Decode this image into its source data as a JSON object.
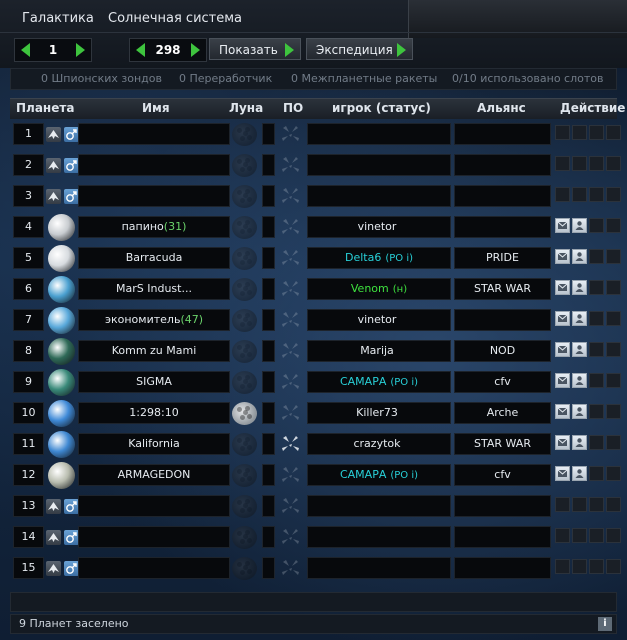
{
  "tabs": [
    "Галактика",
    "Солнечная система"
  ],
  "galaxy_value": "1",
  "system_value": "298",
  "buttons": {
    "show": "Показать",
    "expedition": "Экспедиция"
  },
  "stats": [
    "0 Шпионских зондов",
    "0 Переработчик",
    "0 Межпланетные ракеты",
    "0/10 использовано слотов"
  ],
  "columns": [
    "Планета",
    "Имя",
    "Луна",
    "ПО",
    "игрок (статус)",
    "Альянс",
    "Действие"
  ],
  "rows": [
    {
      "pos": "1",
      "name": "",
      "name_extra": "",
      "player": "",
      "player_status": "",
      "alliance": "",
      "planet": false,
      "moon": false,
      "debris": false,
      "actions": false
    },
    {
      "pos": "2",
      "name": "",
      "name_extra": "",
      "player": "",
      "player_status": "",
      "alliance": "",
      "planet": false,
      "moon": false,
      "debris": false,
      "actions": false
    },
    {
      "pos": "3",
      "name": "",
      "name_extra": "",
      "player": "",
      "player_status": "",
      "alliance": "",
      "planet": false,
      "moon": false,
      "debris": false,
      "actions": false
    },
    {
      "pos": "4",
      "name": "папино",
      "name_extra": "(31)",
      "player": "vinetor",
      "player_status": "",
      "alliance": "",
      "planet": true,
      "planet_color": "#c8ccd0",
      "moon": false,
      "debris": false,
      "actions": true,
      "player_color": "#e6ebf0"
    },
    {
      "pos": "5",
      "name": "Barracuda",
      "name_extra": "",
      "player": "Delta6",
      "player_status": "(PO i)",
      "alliance": "PRIDE",
      "planet": true,
      "planet_color": "#d7dbdf",
      "moon": false,
      "debris": false,
      "actions": true,
      "player_color": "#28d0d8"
    },
    {
      "pos": "6",
      "name": "MarS Indust...",
      "name_extra": "",
      "player": "Venom",
      "player_status": "(н)",
      "alliance": "STAR WAR",
      "planet": true,
      "planet_color": "#4aa0d0",
      "moon": false,
      "debris": false,
      "actions": true,
      "player_color": "#3ee23e"
    },
    {
      "pos": "7",
      "name": "экономитель",
      "name_extra": "(47)",
      "player": "vinetor",
      "player_status": "",
      "alliance": "",
      "planet": true,
      "planet_color": "#58a8da",
      "moon": false,
      "debris": false,
      "actions": true,
      "player_color": "#e6ebf0"
    },
    {
      "pos": "8",
      "name": "Komm zu Mami",
      "name_extra": "",
      "player": "Marija",
      "player_status": "",
      "alliance": "NOD",
      "planet": true,
      "planet_color": "#2f6a58",
      "moon": false,
      "debris": false,
      "actions": true,
      "player_color": "#e6ebf0"
    },
    {
      "pos": "9",
      "name": "SIGMA",
      "name_extra": "",
      "player": "САМАРА",
      "player_status": "(PO i)",
      "alliance": "cfv",
      "planet": true,
      "planet_color": "#3a8a7a",
      "moon": false,
      "debris": false,
      "actions": true,
      "player_color": "#28d0d8"
    },
    {
      "pos": "10",
      "name": "1:298:10",
      "name_extra": "",
      "player": "Killer73",
      "player_status": "",
      "alliance": "Arche",
      "planet": true,
      "planet_color": "#3f8ad8",
      "moon": true,
      "debris": false,
      "actions": true,
      "player_color": "#e6ebf0"
    },
    {
      "pos": "11",
      "name": "Kalifornia",
      "name_extra": "",
      "player": "crazytok",
      "player_status": "",
      "alliance": "STAR WAR",
      "planet": true,
      "planet_color": "#3f88d2",
      "moon": false,
      "debris": true,
      "actions": true,
      "player_color": "#e6ebf0"
    },
    {
      "pos": "12",
      "name": "ARMAGEDON",
      "name_extra": "",
      "player": "САМАРА",
      "player_status": "(PO i)",
      "alliance": "cfv",
      "planet": true,
      "planet_color": "#b8bcae",
      "moon": false,
      "debris": false,
      "actions": true,
      "player_color": "#28d0d8"
    },
    {
      "pos": "13",
      "name": "",
      "name_extra": "",
      "player": "",
      "player_status": "",
      "alliance": "",
      "planet": false,
      "moon": false,
      "debris": false,
      "actions": false
    },
    {
      "pos": "14",
      "name": "",
      "name_extra": "",
      "player": "",
      "player_status": "",
      "alliance": "",
      "planet": false,
      "moon": false,
      "debris": false,
      "actions": false
    },
    {
      "pos": "15",
      "name": "",
      "name_extra": "",
      "player": "",
      "player_status": "",
      "alliance": "",
      "planet": false,
      "moon": false,
      "debris": false,
      "actions": false
    }
  ],
  "footer_text": "9 Планет заселено",
  "info_label": "i"
}
